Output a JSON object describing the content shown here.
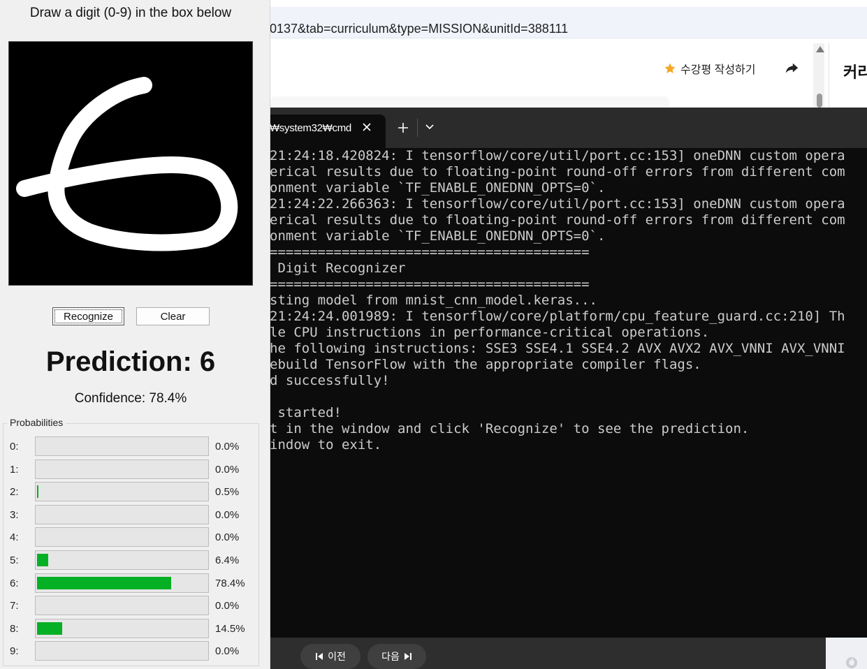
{
  "browser": {
    "url": "0137&tab=curriculum&type=MISSION&unitId=388111",
    "review_label": "수강평 작성하기",
    "side_title": "커리"
  },
  "terminal": {
    "tab_title": "₩system32₩cmd",
    "lines": [
      "21:24:18.420824: I tensorflow/core/util/port.cc:153] oneDNN custom opera",
      "erical results due to floating-point round-off errors from different com",
      "onment variable `TF_ENABLE_ONEDNN_OPTS=0`.",
      "21:24:22.266363: I tensorflow/core/util/port.cc:153] oneDNN custom opera",
      "erical results due to floating-point round-off errors from different com",
      "onment variable `TF_ENABLE_ONEDNN_OPTS=0`.",
      "========================================",
      " Digit Recognizer",
      "========================================",
      "sting model from mnist_cnn_model.keras...",
      "21:24:24.001989: I tensorflow/core/platform/cpu_feature_guard.cc:210] Th",
      "le CPU instructions in performance-critical operations.",
      "he following instructions: SSE3 SSE4.1 SSE4.2 AVX AVX2 AVX_VNNI AVX_VNNI",
      "ebuild TensorFlow with the appropriate compiler flags.",
      "d successfully!",
      "",
      " started!",
      "t in the window and click 'Recognize' to see the prediction.",
      "indow to exit."
    ]
  },
  "bottom_nav": {
    "prev_label": "이전",
    "next_label": "다음"
  },
  "recognizer": {
    "instruction": "Draw a digit (0-9) in the box below",
    "recognize_label": "Recognize",
    "clear_label": "Clear",
    "prediction": "Prediction: 6",
    "confidence": "Confidence: 78.4%",
    "probabilities_label": "Probabilities",
    "probabilities": [
      {
        "digit": "0:",
        "pct": "0.0%",
        "value": 0.0
      },
      {
        "digit": "1:",
        "pct": "0.0%",
        "value": 0.0
      },
      {
        "digit": "2:",
        "pct": "0.5%",
        "value": 0.5
      },
      {
        "digit": "3:",
        "pct": "0.0%",
        "value": 0.0
      },
      {
        "digit": "4:",
        "pct": "0.0%",
        "value": 0.0
      },
      {
        "digit": "5:",
        "pct": "6.4%",
        "value": 6.4
      },
      {
        "digit": "6:",
        "pct": "78.4%",
        "value": 78.4
      },
      {
        "digit": "7:",
        "pct": "0.0%",
        "value": 0.0
      },
      {
        "digit": "8:",
        "pct": "14.5%",
        "value": 14.5
      },
      {
        "digit": "9:",
        "pct": "0.0%",
        "value": 0.0
      }
    ]
  },
  "colors": {
    "bar_fill": "#06b025",
    "terminal_bg": "#0c0c0c",
    "terminal_text": "#cccccc",
    "star": "#f5a623"
  },
  "icons": [
    "star-icon",
    "share-icon",
    "close-icon",
    "plus-icon",
    "chevron-down-icon",
    "skip-back-icon",
    "skip-forward-icon",
    "fire-icon",
    "scroll-up-icon"
  ]
}
